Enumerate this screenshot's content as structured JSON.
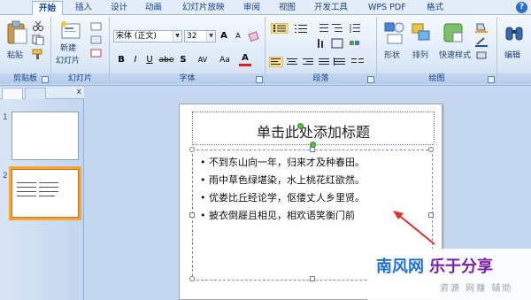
{
  "tabs": [
    {
      "label": "开始",
      "active": true
    },
    {
      "label": "插入"
    },
    {
      "label": "设计"
    },
    {
      "label": "动画"
    },
    {
      "label": "幻灯片放映"
    },
    {
      "label": "审阅"
    },
    {
      "label": "视图"
    },
    {
      "label": "开发工具"
    },
    {
      "label": "WPS PDF"
    },
    {
      "label": "格式"
    }
  ],
  "help_icon": "?",
  "ribbon": {
    "clipboard": {
      "label": "剪贴板",
      "paste": "粘贴"
    },
    "slides": {
      "label": "幻灯片",
      "new_slide": "新建",
      "new_slide_2": "幻灯片"
    },
    "font": {
      "label": "字体",
      "font_name": "宋体 (正文)",
      "font_size": "32",
      "bold": "B",
      "italic": "I",
      "underline": "U",
      "strike": "abe",
      "shadow": "S",
      "spacing": "AV",
      "case": "Aa",
      "color": "A",
      "grow": "A",
      "shrink": "A"
    },
    "paragraph": {
      "label": "段落"
    },
    "drawing": {
      "label": "绘图",
      "shapes": "形状",
      "arrange": "排列",
      "quick_styles": "快速样式"
    },
    "editing": {
      "label": "编辑"
    }
  },
  "slides_panel": {
    "close": "x",
    "slides": [
      {
        "number": "1"
      },
      {
        "number": "2"
      }
    ]
  },
  "slide": {
    "title": "单击此处添加标题",
    "bullets": [
      "不到东山向一年，归来才及种春田。",
      "雨中草色绿堪染，水上桃花红欲然。",
      "优娄比丘经论学，伛偻丈人乡里贤。",
      "披衣倒屣且相见，相欢语笑衡门前"
    ],
    "bullet_char": "•"
  },
  "watermark": {
    "brand": "南风网",
    "slogan": "乐于分享",
    "tagline": "资源 网赚 辅助"
  },
  "colors": {
    "ribbon_bg": "#dce8f7",
    "canvas_bg": "#c6d8ef",
    "selected_thumb": "#f6a33a",
    "arrow": "#e03030",
    "wm_brand": "#1f6fd6",
    "wm_slogan": "#7a1fa8"
  }
}
